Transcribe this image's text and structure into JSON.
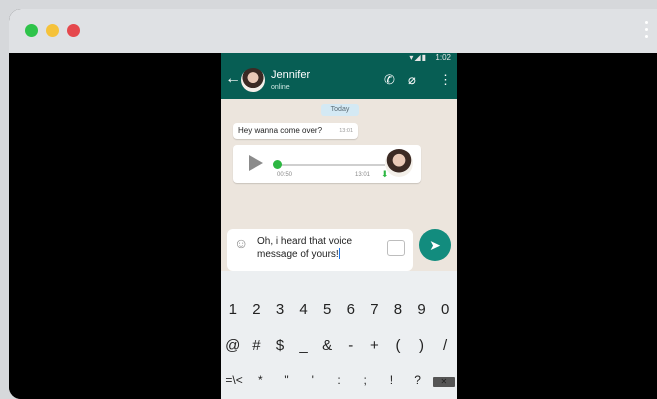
{
  "window_controls": {
    "close": "close",
    "minimize": "minimize",
    "maximize": "maximize"
  },
  "status_bar": {
    "time": "1:02"
  },
  "chat": {
    "contact_name": "Jennifer",
    "contact_status": "online",
    "date_chip": "Today",
    "messages": [
      {
        "text": "Hey wanna come over?",
        "time": "13:01"
      }
    ],
    "voice_message": {
      "duration": "00:50",
      "time": "13:01"
    }
  },
  "composer": {
    "value": "Oh, i heard that voice message of yours!"
  },
  "keyboard": {
    "row1": [
      "1",
      "2",
      "3",
      "4",
      "5",
      "6",
      "7",
      "8",
      "9",
      "0"
    ],
    "row2": [
      "@",
      "#",
      "$",
      "_",
      "&",
      "-",
      "+",
      "(",
      ")",
      "/"
    ],
    "row3": [
      "=\\<",
      "*",
      "\"",
      "'",
      ":",
      ";",
      "!",
      "?"
    ]
  },
  "icons": {
    "back": "arrow-left-icon",
    "call": "phone-icon",
    "attach": "paperclip-icon",
    "menu": "kebab-icon",
    "play": "play-icon",
    "mic": "mic-icon",
    "emoji": "smiley-icon",
    "camera": "camera-icon",
    "send": "send-icon"
  },
  "colors": {
    "header": "#075e54",
    "accent": "#128c7e",
    "chat_bg": "#ece5dd",
    "voice_progress": "#2db742"
  }
}
